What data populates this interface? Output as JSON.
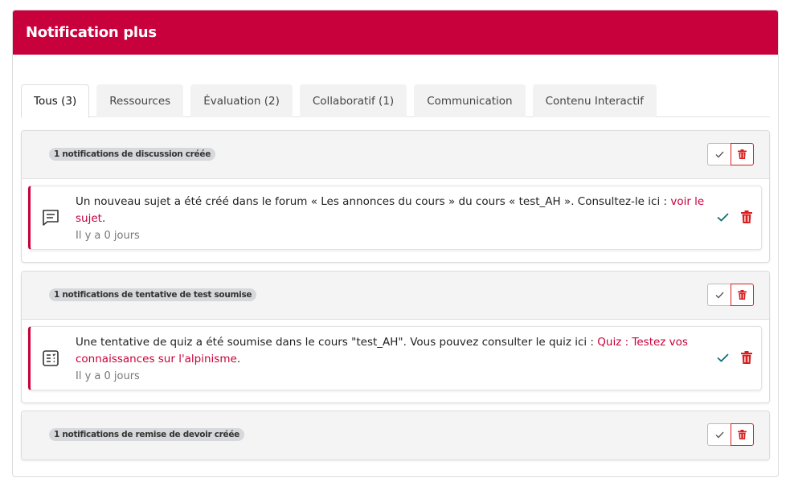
{
  "header": {
    "title": "Notification plus"
  },
  "tabs": [
    {
      "label": "Tous (3)"
    },
    {
      "label": "Ressources"
    },
    {
      "label": "Évaluation (2)"
    },
    {
      "label": "Collaboratif (1)"
    },
    {
      "label": "Communication"
    },
    {
      "label": "Contenu Interactif"
    }
  ],
  "groups": [
    {
      "badge": "1 notifications de discussion créée",
      "item": {
        "icon": "message-icon",
        "text": "Un nouveau sujet a été créé dans le forum « Les annonces du cours » du cours « test_AH ». Consultez-le ici : ",
        "link": "voir le sujet",
        "suffix": ".",
        "time": "Il y a 0 jours"
      }
    },
    {
      "badge": "1 notifications de tentative de test soumise",
      "item": {
        "icon": "quiz-list-icon",
        "text": "Une tentative de quiz a été soumise dans le cours \"test_AH\". Vous pouvez consulter le quiz ici : ",
        "link": "Quiz : Testez vos connaissances sur l'alpinisme",
        "suffix": ".",
        "time": "Il y a 0 jours"
      }
    },
    {
      "badge": "1 notifications de remise de devoir créée"
    }
  ],
  "colors": {
    "brand": "#c8003c",
    "check": "#0e6f7a",
    "delete": "#d81e1e"
  }
}
